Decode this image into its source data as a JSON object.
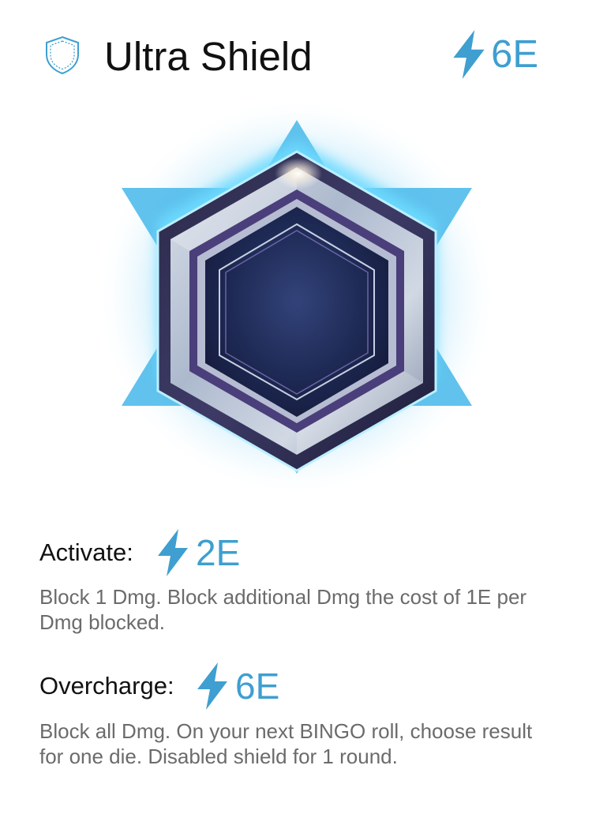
{
  "card": {
    "title": "Ultra Shield",
    "icon": "shield-outline-icon",
    "cost": "6E",
    "cost_icon": "lightning-bolt-icon",
    "art_icon": "hexagon-shield-emblem",
    "accent_color": "#3e9fd0"
  },
  "abilities": [
    {
      "label": "Activate:",
      "cost": "2E",
      "text": "Block 1 Dmg. Block additional Dmg the cost of 1E per Dmg blocked."
    },
    {
      "label": "Overcharge:",
      "cost": "6E",
      "text": "Block all Dmg. On your next BINGO roll, choose result for one die. Disabled shield for 1 round."
    }
  ]
}
